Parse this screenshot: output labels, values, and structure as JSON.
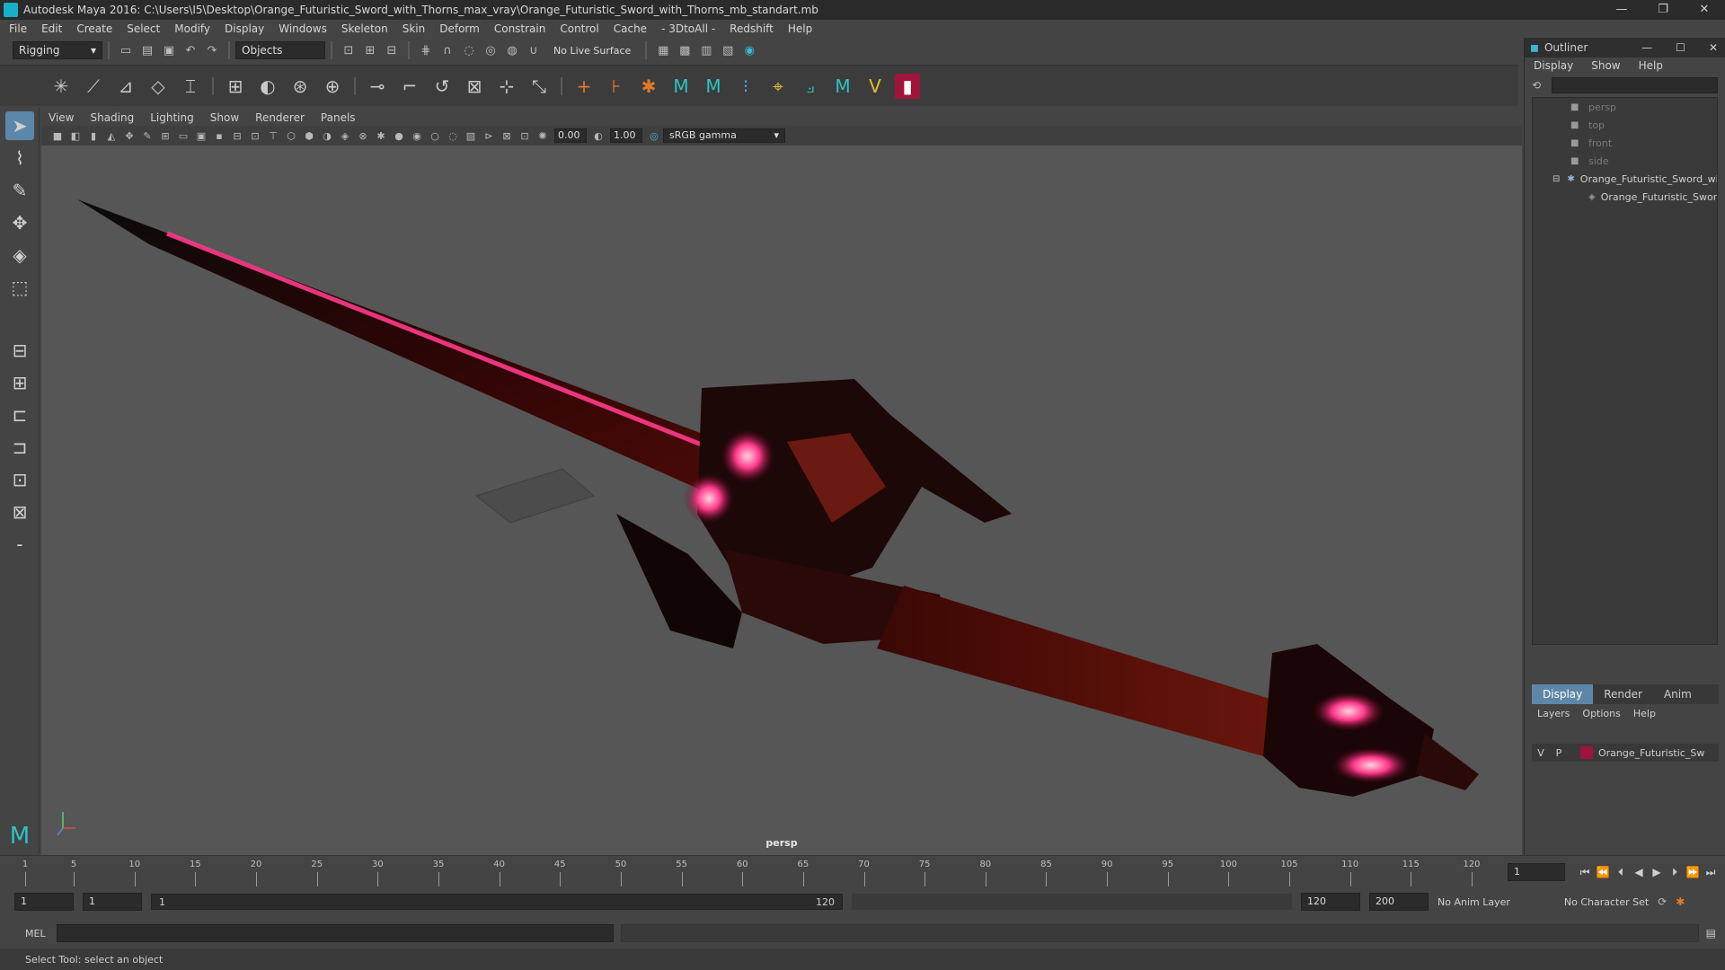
{
  "window": {
    "title": "Autodesk Maya 2016: C:\\Users\\I5\\Desktop\\Orange_Futuristic_Sword_with_Thorns_max_vray\\Orange_Futuristic_Sword_with_Thorns_mb_standart.mb",
    "minimize": "—",
    "restore": "❐",
    "close": "✕"
  },
  "menubar": [
    "File",
    "Edit",
    "Create",
    "Select",
    "Modify",
    "Display",
    "Windows",
    "Skeleton",
    "Skin",
    "Deform",
    "Constrain",
    "Control",
    "Cache",
    "- 3DtoAll -",
    "Redshift",
    "Help"
  ],
  "statusline": {
    "menuset": "Rigging",
    "selection_mode": "Objects",
    "live_surface": "No Live Surface"
  },
  "panel": {
    "menus": [
      "View",
      "Shading",
      "Lighting",
      "Show",
      "Renderer",
      "Panels"
    ],
    "exposure": "0.00",
    "gamma": "1.00",
    "colorspace": "sRGB gamma",
    "camera": "persp"
  },
  "outliner": {
    "title": "Outliner",
    "menus": [
      "Display",
      "Show",
      "Help"
    ],
    "items": [
      {
        "label": "persp",
        "dim": true
      },
      {
        "label": "top",
        "dim": true
      },
      {
        "label": "front",
        "dim": true
      },
      {
        "label": "side",
        "dim": true
      },
      {
        "label": "Orange_Futuristic_Sword_wi",
        "dim": false
      },
      {
        "label": "Orange_Futuristic_Sword",
        "dim": false
      }
    ]
  },
  "layers": {
    "tabs": [
      "Display",
      "Render",
      "Anim"
    ],
    "active_tab": "Display",
    "menus": [
      "Layers",
      "Options",
      "Help"
    ],
    "row": {
      "v": "V",
      "p": "P",
      "name": "Orange_Futuristic_Sw",
      "color": "#a0143c"
    }
  },
  "timeline": {
    "ticks": [
      "1",
      "5",
      "10",
      "15",
      "20",
      "25",
      "30",
      "35",
      "40",
      "45",
      "50",
      "55",
      "60",
      "65",
      "70",
      "75",
      "80",
      "85",
      "90",
      "95",
      "100",
      "105",
      "110",
      "115",
      "120"
    ],
    "current_frame": "1"
  },
  "range": {
    "start": "1",
    "playback_start": "1",
    "slider_start": "1",
    "slider_end": "120",
    "playback_end": "120",
    "end": "200",
    "anim_layer": "No Anim Layer",
    "character_set": "No Character Set"
  },
  "cmdline": {
    "label": "MEL"
  },
  "helpline": {
    "text": "Select Tool: select an object"
  }
}
